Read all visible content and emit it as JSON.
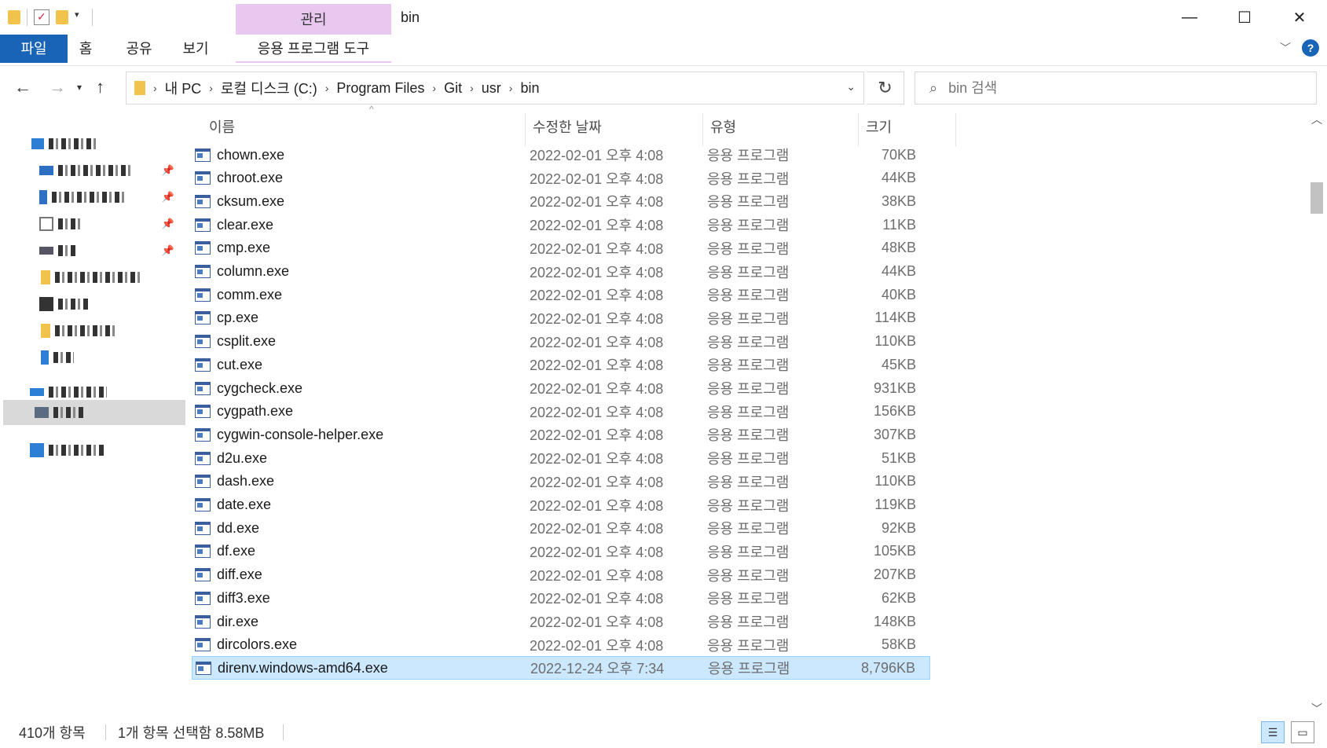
{
  "window": {
    "title": "bin",
    "contextual_tab": "관리",
    "minimize": "—",
    "maximize": "☐",
    "close": "✕"
  },
  "ribbon": {
    "tabs": [
      "파일",
      "홈",
      "공유",
      "보기",
      "응용 프로그램 도구"
    ]
  },
  "address": {
    "crumbs": [
      "내 PC",
      "로컬 디스크 (C:)",
      "Program Files",
      "Git",
      "usr",
      "bin"
    ],
    "search_placeholder": "bin 검색"
  },
  "columns": {
    "name": "이름",
    "date": "수정한 날짜",
    "type": "유형",
    "size": "크기"
  },
  "files": [
    {
      "name": "chown.exe",
      "date": "2022-02-01 오후 4:08",
      "type": "응용 프로그램",
      "size": "70KB"
    },
    {
      "name": "chroot.exe",
      "date": "2022-02-01 오후 4:08",
      "type": "응용 프로그램",
      "size": "44KB"
    },
    {
      "name": "cksum.exe",
      "date": "2022-02-01 오후 4:08",
      "type": "응용 프로그램",
      "size": "38KB"
    },
    {
      "name": "clear.exe",
      "date": "2022-02-01 오후 4:08",
      "type": "응용 프로그램",
      "size": "11KB"
    },
    {
      "name": "cmp.exe",
      "date": "2022-02-01 오후 4:08",
      "type": "응용 프로그램",
      "size": "48KB"
    },
    {
      "name": "column.exe",
      "date": "2022-02-01 오후 4:08",
      "type": "응용 프로그램",
      "size": "44KB"
    },
    {
      "name": "comm.exe",
      "date": "2022-02-01 오후 4:08",
      "type": "응용 프로그램",
      "size": "40KB"
    },
    {
      "name": "cp.exe",
      "date": "2022-02-01 오후 4:08",
      "type": "응용 프로그램",
      "size": "114KB"
    },
    {
      "name": "csplit.exe",
      "date": "2022-02-01 오후 4:08",
      "type": "응용 프로그램",
      "size": "110KB"
    },
    {
      "name": "cut.exe",
      "date": "2022-02-01 오후 4:08",
      "type": "응용 프로그램",
      "size": "45KB"
    },
    {
      "name": "cygcheck.exe",
      "date": "2022-02-01 오후 4:08",
      "type": "응용 프로그램",
      "size": "931KB"
    },
    {
      "name": "cygpath.exe",
      "date": "2022-02-01 오후 4:08",
      "type": "응용 프로그램",
      "size": "156KB"
    },
    {
      "name": "cygwin-console-helper.exe",
      "date": "2022-02-01 오후 4:08",
      "type": "응용 프로그램",
      "size": "307KB"
    },
    {
      "name": "d2u.exe",
      "date": "2022-02-01 오후 4:08",
      "type": "응용 프로그램",
      "size": "51KB"
    },
    {
      "name": "dash.exe",
      "date": "2022-02-01 오후 4:08",
      "type": "응용 프로그램",
      "size": "110KB"
    },
    {
      "name": "date.exe",
      "date": "2022-02-01 오후 4:08",
      "type": "응용 프로그램",
      "size": "119KB"
    },
    {
      "name": "dd.exe",
      "date": "2022-02-01 오후 4:08",
      "type": "응용 프로그램",
      "size": "92KB"
    },
    {
      "name": "df.exe",
      "date": "2022-02-01 오후 4:08",
      "type": "응용 프로그램",
      "size": "105KB"
    },
    {
      "name": "diff.exe",
      "date": "2022-02-01 오후 4:08",
      "type": "응용 프로그램",
      "size": "207KB"
    },
    {
      "name": "diff3.exe",
      "date": "2022-02-01 오후 4:08",
      "type": "응용 프로그램",
      "size": "62KB"
    },
    {
      "name": "dir.exe",
      "date": "2022-02-01 오후 4:08",
      "type": "응용 프로그램",
      "size": "148KB"
    },
    {
      "name": "dircolors.exe",
      "date": "2022-02-01 오후 4:08",
      "type": "응용 프로그램",
      "size": "58KB"
    },
    {
      "name": "direnv.windows-amd64.exe",
      "date": "2022-12-24 오후 7:34",
      "type": "응용 프로그램",
      "size": "8,796KB",
      "selected": true
    }
  ],
  "status": {
    "count": "410개 항목",
    "selection": "1개 항목 선택함 8.58MB"
  },
  "colors": {
    "file_tab": "#1a64b8",
    "manage_tab": "#e9c8f0",
    "selection": "#cce8ff"
  }
}
